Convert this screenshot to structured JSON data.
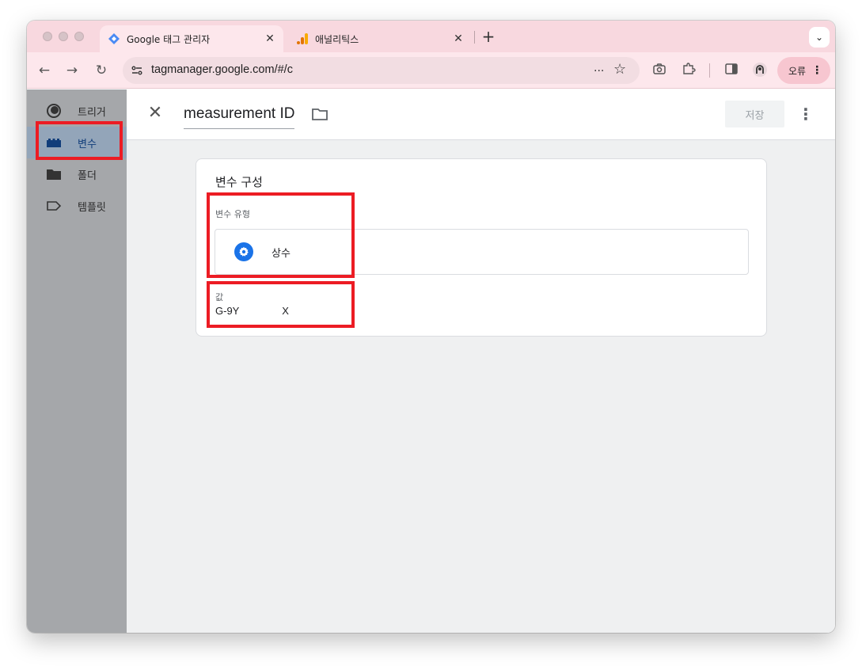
{
  "browser": {
    "tabs": [
      {
        "title": "Google 태그 관리자",
        "active": true,
        "favicon": "gtm-diamond-icon"
      },
      {
        "title": "애널리틱스",
        "active": false,
        "favicon": "analytics-bars-icon"
      }
    ],
    "close_glyph": "✕",
    "new_tab_glyph": "+",
    "tab_search_glyph": "⌄",
    "url": "tagmanager.google.com/#/c",
    "url_more": "...",
    "error_button": "오류"
  },
  "sidebar": {
    "items": [
      {
        "label": "트리거",
        "icon": "trigger-icon"
      },
      {
        "label": "변수",
        "icon": "variable-icon",
        "selected": true
      },
      {
        "label": "폴더",
        "icon": "folder-icon"
      },
      {
        "label": "템플릿",
        "icon": "template-tag-icon"
      }
    ]
  },
  "header": {
    "close_glyph": "✕",
    "variable_name": "measurement ID",
    "save_label": "저장",
    "more_glyph": "⋮"
  },
  "card": {
    "title": "변수 구성",
    "type_label": "변수 유형",
    "type_name": "상수",
    "value_label": "값",
    "value": "G-9Y               X"
  },
  "colors": {
    "highlight": "#ec1c24",
    "accent": "#1a73e8",
    "tab_strip": "#f8d8df"
  }
}
